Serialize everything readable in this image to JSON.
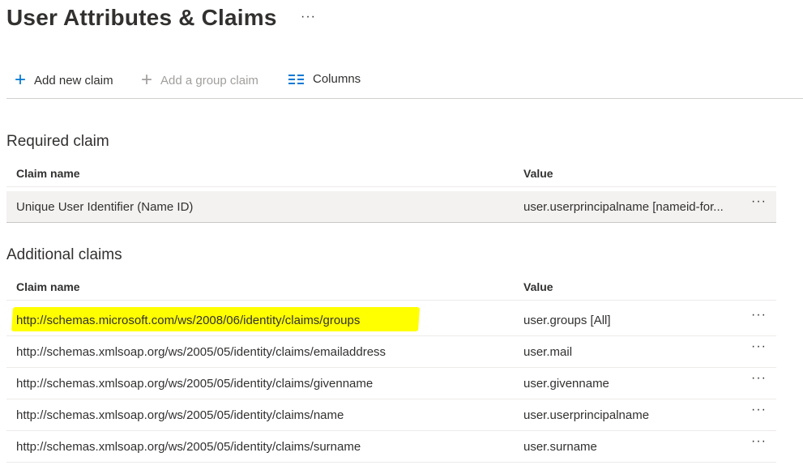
{
  "header": {
    "title": "User Attributes & Claims",
    "more": "···"
  },
  "toolbar": {
    "add_new_claim": "Add new claim",
    "add_group_claim": "Add a group claim",
    "columns": "Columns"
  },
  "required": {
    "heading": "Required claim",
    "columns": [
      "Claim name",
      "Value"
    ],
    "rows": [
      {
        "name": "Unique User Identifier (Name ID)",
        "value": "user.userprincipalname [nameid-for...",
        "more": "···"
      }
    ]
  },
  "additional": {
    "heading": "Additional claims",
    "columns": [
      "Claim name",
      "Value"
    ],
    "rows": [
      {
        "name": "http://schemas.microsoft.com/ws/2008/06/identity/claims/groups",
        "value": "user.groups [All]",
        "more": "···"
      },
      {
        "name": "http://schemas.xmlsoap.org/ws/2005/05/identity/claims/emailaddress",
        "value": "user.mail",
        "more": "···"
      },
      {
        "name": "http://schemas.xmlsoap.org/ws/2005/05/identity/claims/givenname",
        "value": "user.givenname",
        "more": "···"
      },
      {
        "name": "http://schemas.xmlsoap.org/ws/2005/05/identity/claims/name",
        "value": "user.userprincipalname",
        "more": "···"
      },
      {
        "name": "http://schemas.xmlsoap.org/ws/2005/05/identity/claims/surname",
        "value": "user.surname",
        "more": "···"
      }
    ]
  },
  "colors": {
    "accent": "#0078d4",
    "highlight": "#ffff00"
  }
}
